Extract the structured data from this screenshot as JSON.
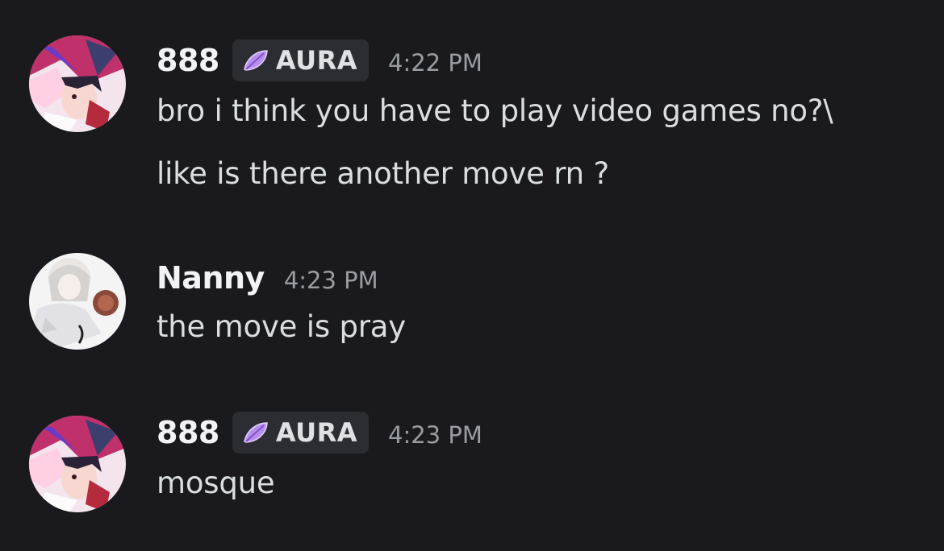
{
  "messages": [
    {
      "username": "888",
      "tag": {
        "label": "AURA",
        "icon": "purple-leaf-icon",
        "color": "#b98ef0"
      },
      "timestamp": "4:22 PM",
      "lines": [
        "bro i think you have to play video games no?\\",
        "like is there another move rn ?"
      ]
    },
    {
      "username": "Nanny",
      "timestamp": "4:23 PM",
      "lines": [
        "the move is pray"
      ]
    },
    {
      "username": "888",
      "tag": {
        "label": "AURA",
        "icon": "purple-leaf-icon",
        "color": "#b98ef0"
      },
      "timestamp": "4:23 PM",
      "lines": [
        "mosque"
      ]
    }
  ],
  "colors": {
    "background": "#1a1a1e",
    "username": "#f2f3f5",
    "message_text": "#dbdee1",
    "timestamp": "#9a9ca3",
    "tag_background": "#2b2d33"
  }
}
